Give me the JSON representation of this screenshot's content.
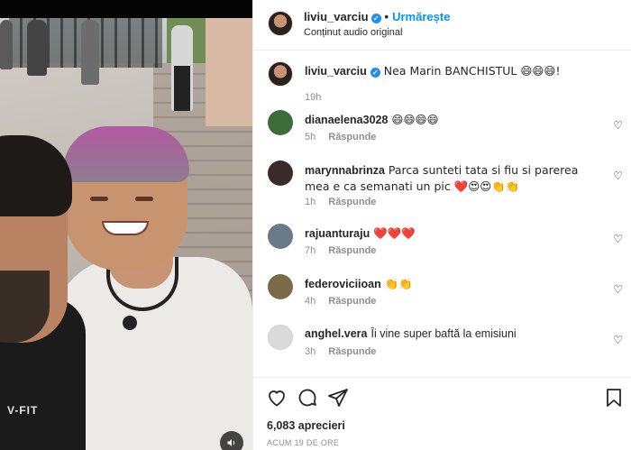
{
  "post": {
    "username": "liviu_varciu",
    "follow_label": "Urmărește",
    "separator": "•",
    "audio_label": "Conținut audio original",
    "caption_username": "liviu_varciu",
    "caption_text": "Nea Marin BANCHISTUL 😄😄😄!",
    "caption_time": "19h",
    "likes": "6,083 aprecieri",
    "time_ago": "ACUM 19 DE ORE",
    "shirt_text": "V-FIT"
  },
  "reply_label": "Răspunde",
  "comments": [
    {
      "username": "dianaelena3028",
      "text": "😄😄😄😄",
      "time": "5h",
      "avatar_color": "#3e6b3a"
    },
    {
      "username": "marynnabrinza",
      "text": "Parca sunteti tata si fiu si parerea mea e ca semanati un pic ❤️😍😍👏👏",
      "time": "1h",
      "avatar_color": "#3a2a2a"
    },
    {
      "username": "rajuanturaju",
      "text": "❤️❤️❤️",
      "time": "7h",
      "avatar_color": "#6b7a88"
    },
    {
      "username": "federoviciioan",
      "text": "👏👏",
      "time": "4h",
      "avatar_color": "#7a6a4a"
    },
    {
      "username": "anghel.vera",
      "text": "Îi vine super baftă la emisiuni",
      "time": "3h",
      "avatar_color": "#dadada"
    }
  ],
  "icons": {
    "verified": "verified-badge-icon",
    "heart": "heart-icon",
    "comment": "comment-icon",
    "share": "share-icon",
    "bookmark": "bookmark-icon",
    "audio": "speaker-icon"
  },
  "colors": {
    "accent": "#0095f6",
    "verified": "#1f8ef1",
    "muted": "#8e8e8e",
    "heart_red": "#ed4956"
  }
}
